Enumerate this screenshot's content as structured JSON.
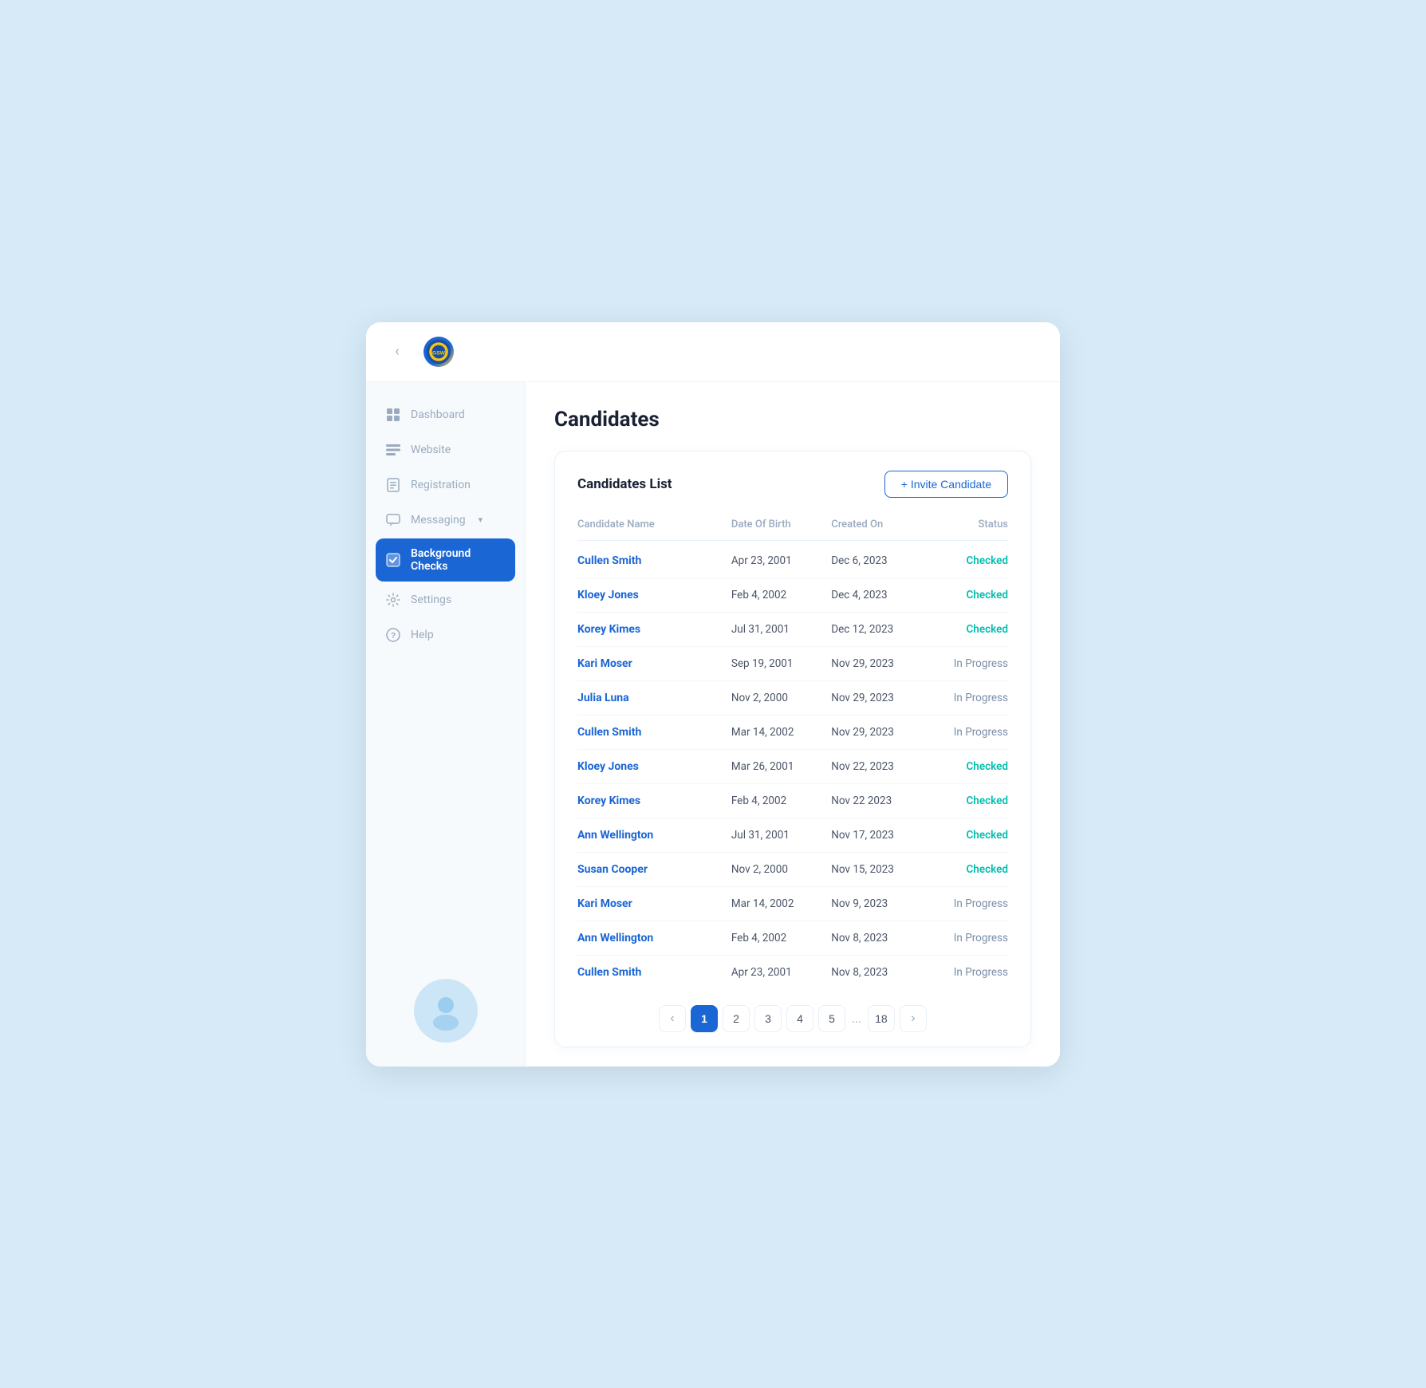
{
  "header": {
    "collapse_icon": "‹",
    "logo_alt": "Golden State Warriors"
  },
  "sidebar": {
    "items": [
      {
        "id": "dashboard",
        "label": "Dashboard",
        "active": false
      },
      {
        "id": "website",
        "label": "Website",
        "active": false
      },
      {
        "id": "registration",
        "label": "Registration",
        "active": false
      },
      {
        "id": "messaging",
        "label": "Messaging",
        "active": false,
        "has_arrow": true
      },
      {
        "id": "background-checks",
        "label": "Background Checks",
        "active": true
      },
      {
        "id": "settings",
        "label": "Settings",
        "active": false
      },
      {
        "id": "help",
        "label": "Help",
        "active": false
      }
    ]
  },
  "page": {
    "title": "Candidates",
    "card": {
      "title": "Candidates List",
      "invite_button": "+ Invite Candidate",
      "columns": [
        "Candidate Name",
        "Date Of Birth",
        "Created On",
        "Status"
      ],
      "rows": [
        {
          "name": "Cullen Smith",
          "dob": "Apr 23, 2001",
          "created": "Dec 6, 2023",
          "status": "Checked",
          "status_type": "checked"
        },
        {
          "name": "Kloey Jones",
          "dob": "Feb 4, 2002",
          "created": "Dec 4, 2023",
          "status": "Checked",
          "status_type": "checked"
        },
        {
          "name": "Korey Kimes",
          "dob": "Jul 31, 2001",
          "created": "Dec 12, 2023",
          "status": "Checked",
          "status_type": "checked"
        },
        {
          "name": "Kari Moser",
          "dob": "Sep 19, 2001",
          "created": "Nov 29, 2023",
          "status": "In Progress",
          "status_type": "progress"
        },
        {
          "name": "Julia Luna",
          "dob": "Nov 2, 2000",
          "created": "Nov 29, 2023",
          "status": "In Progress",
          "status_type": "progress"
        },
        {
          "name": "Cullen Smith",
          "dob": "Mar 14, 2002",
          "created": "Nov 29, 2023",
          "status": "In Progress",
          "status_type": "progress"
        },
        {
          "name": "Kloey Jones",
          "dob": "Mar 26, 2001",
          "created": "Nov 22, 2023",
          "status": "Checked",
          "status_type": "checked"
        },
        {
          "name": "Korey Kimes",
          "dob": "Feb 4, 2002",
          "created": "Nov 22 2023",
          "status": "Checked",
          "status_type": "checked"
        },
        {
          "name": "Ann Wellington",
          "dob": "Jul 31, 2001",
          "created": "Nov 17, 2023",
          "status": "Checked",
          "status_type": "checked"
        },
        {
          "name": "Susan Cooper",
          "dob": "Nov 2, 2000",
          "created": "Nov 15, 2023",
          "status": "Checked",
          "status_type": "checked"
        },
        {
          "name": "Kari Moser",
          "dob": "Mar 14, 2002",
          "created": "Nov 9, 2023",
          "status": "In Progress",
          "status_type": "progress"
        },
        {
          "name": "Ann Wellington",
          "dob": "Feb 4, 2002",
          "created": "Nov 8, 2023",
          "status": "In Progress",
          "status_type": "progress"
        },
        {
          "name": "Cullen Smith",
          "dob": "Apr 23, 2001",
          "created": "Nov 8, 2023",
          "status": "In Progress",
          "status_type": "progress"
        }
      ]
    },
    "pagination": {
      "prev": "‹",
      "next": "›",
      "pages": [
        "1",
        "2",
        "3",
        "4",
        "5",
        "...",
        "18"
      ],
      "active_page": "1"
    }
  }
}
